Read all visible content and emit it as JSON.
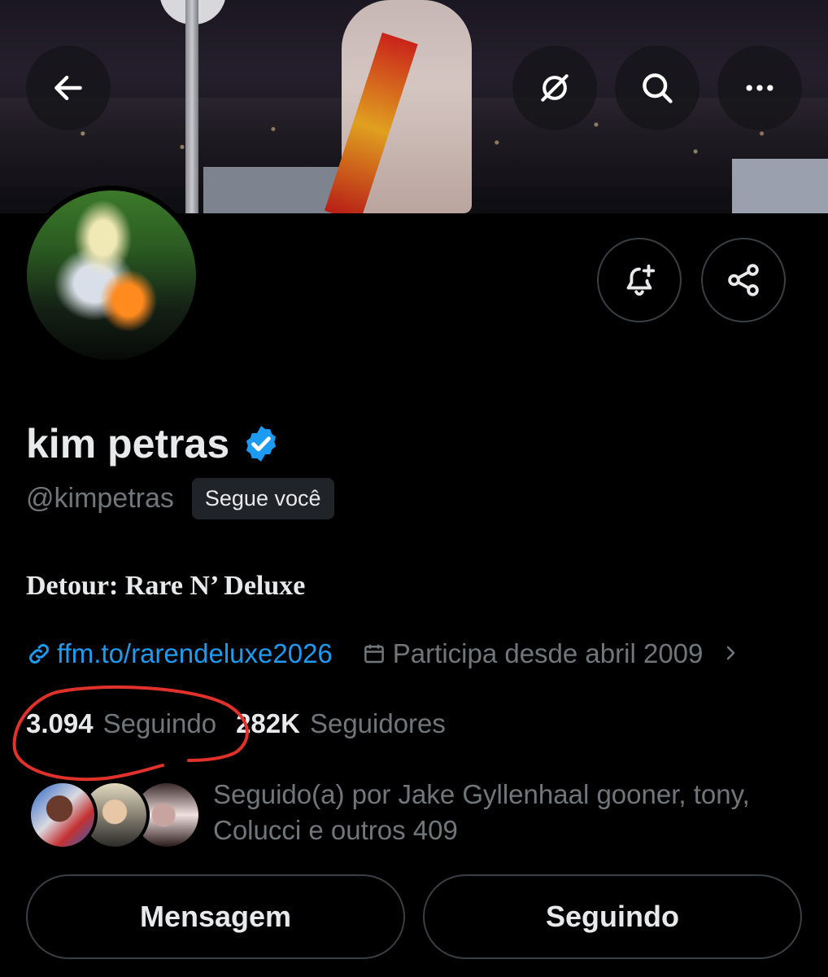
{
  "header": {
    "back_icon": "arrow-left-icon",
    "grok_icon": "grok-icon",
    "search_icon": "search-icon",
    "more_icon": "more-icon"
  },
  "profile": {
    "name": "kim petras",
    "verified": true,
    "handle": "@kimpetras",
    "follows_you_label": "Segue você",
    "bio": "Detour: Rare N’ Deluxe",
    "link_text": "ffm.to/rarendeluxe2026",
    "joined_text": "Participa desde abril 2009",
    "following_count": "3.094",
    "following_label": "Seguindo",
    "followers_count": "282K",
    "followers_label": "Seguidores",
    "followed_by_text": "Seguido(a) por Jake Gyllenhaal gooner, tony, Colucci e outros 409"
  },
  "actions": {
    "message_label": "Mensagem",
    "following_button_label": "Seguindo"
  },
  "colors": {
    "accent": "#1d9bf0",
    "muted_text": "#71767b",
    "annotation": "#e0322a"
  }
}
